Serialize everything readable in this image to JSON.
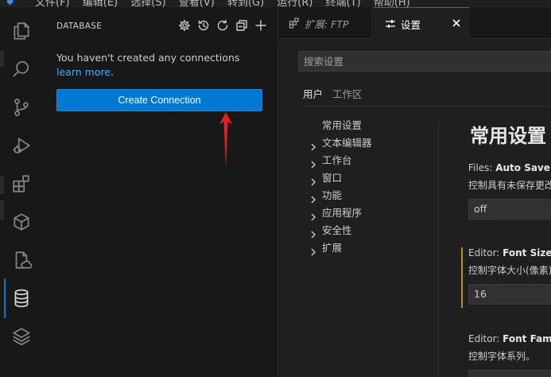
{
  "titlebar": {
    "menu_text": "文件(F)  编辑(E)  选择(S)  查看(V)  转到(G)  运行(R)  终端(T)  帮助(H)"
  },
  "activity": {
    "items": [
      "explorer-icon",
      "search-icon",
      "source-control-icon",
      "run-debug-icon",
      "extensions-icon",
      "package-icon",
      "remote-file-icon",
      "database-icon",
      "layers-icon"
    ],
    "active": "database-icon"
  },
  "sidebar": {
    "title": "DATABASE",
    "message_prefix": "You haven't created any connections ",
    "message_link": "learn more",
    "message_suffix": ".",
    "create_button": "Create Connection",
    "actions": [
      "gear-icon",
      "history-icon",
      "refresh-icon",
      "collapse-all-icon",
      "add-icon"
    ]
  },
  "editor": {
    "tabs": [
      {
        "label": "扩展: FTP",
        "icon": "extension-file-icon",
        "active": false
      },
      {
        "label": "设置",
        "icon": "settings-sliders-icon",
        "active": true
      }
    ],
    "search_placeholder": "搜索设置",
    "scopes": [
      {
        "label": "用户",
        "active": true
      },
      {
        "label": "工作区",
        "active": false
      }
    ],
    "toc": [
      {
        "label": "常用设置",
        "expandable": false
      },
      {
        "label": "文本编辑器",
        "expandable": true
      },
      {
        "label": "工作台",
        "expandable": true
      },
      {
        "label": "窗口",
        "expandable": true
      },
      {
        "label": "功能",
        "expandable": true
      },
      {
        "label": "应用程序",
        "expandable": true
      },
      {
        "label": "安全性",
        "expandable": true
      },
      {
        "label": "扩展",
        "expandable": true
      }
    ],
    "heading": "常用设置",
    "settings": [
      {
        "prefix": "Files: ",
        "name": "Auto Save",
        "desc": "控制具有未保存更改的编辑器的自动保存。",
        "value": "off",
        "modified": false
      },
      {
        "prefix": "Editor: ",
        "name": "Font Size",
        "desc": "控制字体大小(像素)。",
        "value": "16",
        "modified": true
      },
      {
        "prefix": "Editor: ",
        "name": "Font Family",
        "desc": "控制字体系列。",
        "value": "",
        "modified": false
      }
    ]
  },
  "colors": {
    "accent": "#0078d4",
    "link": "#4daafc",
    "annotation_arrow": "#e02020",
    "modified_bar": "#c08a2c"
  }
}
